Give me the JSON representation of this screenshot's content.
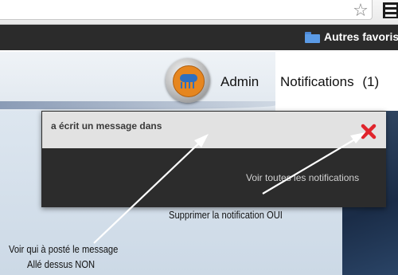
{
  "browser": {
    "bookmarks_folder_label": "Autres favoris"
  },
  "nav": {
    "admin_label": "Admin",
    "notifications_label": "Notifications",
    "notifications_count": "(1)"
  },
  "notifications": {
    "items": [
      {
        "text": "a écrit un message dans"
      }
    ],
    "view_all_label": "Voir toutes les notifications"
  },
  "annotations": {
    "delete_note": "Supprimer la notification OUI",
    "poster_note_line1": "Voir qui à posté le message",
    "poster_note_line2": "Allé dessus NON"
  },
  "icons": {
    "star": "star-icon",
    "menu": "menu-icon",
    "folder": "folder-icon",
    "avatar": "avatar",
    "delete": "close-icon"
  },
  "colors": {
    "bookmarks_bar": "#2b2b2b",
    "dropdown_bg": "#2c2c2c",
    "item_bg": "#e2e2e2",
    "delete_red": "#e0242c",
    "annotation_arrow": "#ffffff"
  }
}
